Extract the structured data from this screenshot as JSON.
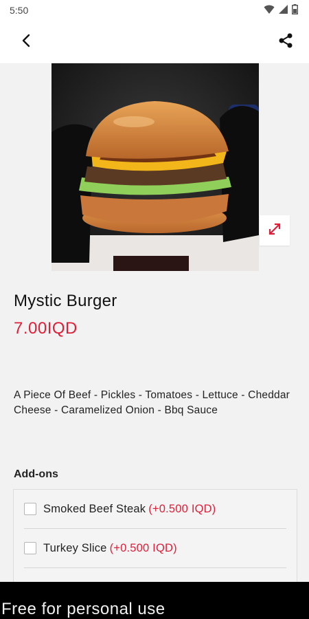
{
  "status_bar": {
    "time": "5:50",
    "icons": [
      "wifi-icon",
      "cellular-signal-icon",
      "battery-icon"
    ]
  },
  "app_bar": {
    "back_icon": "back-arrow-icon",
    "share_icon": "share-icon"
  },
  "product": {
    "image_description_icon": "burger-photo",
    "title": "Mystic Burger",
    "price": "7.00IQD",
    "description": "A Piece Of Beef - Pickles - Tomatoes - Lettuce - Cheddar Cheese - Caramelized Onion - Bbq Sauce"
  },
  "addons": {
    "title": "Add-ons",
    "items": [
      {
        "name": "Smoked Beef Steak",
        "price": "(+0.500 IQD)",
        "checked": false
      },
      {
        "name": "Turkey Slice",
        "price": "(+0.500 IQD)",
        "checked": false
      }
    ]
  },
  "watermark": {
    "text": "Free for personal use"
  },
  "colors": {
    "accent": "#e01e37",
    "background": "#f2f2f2",
    "text": "#111111"
  }
}
